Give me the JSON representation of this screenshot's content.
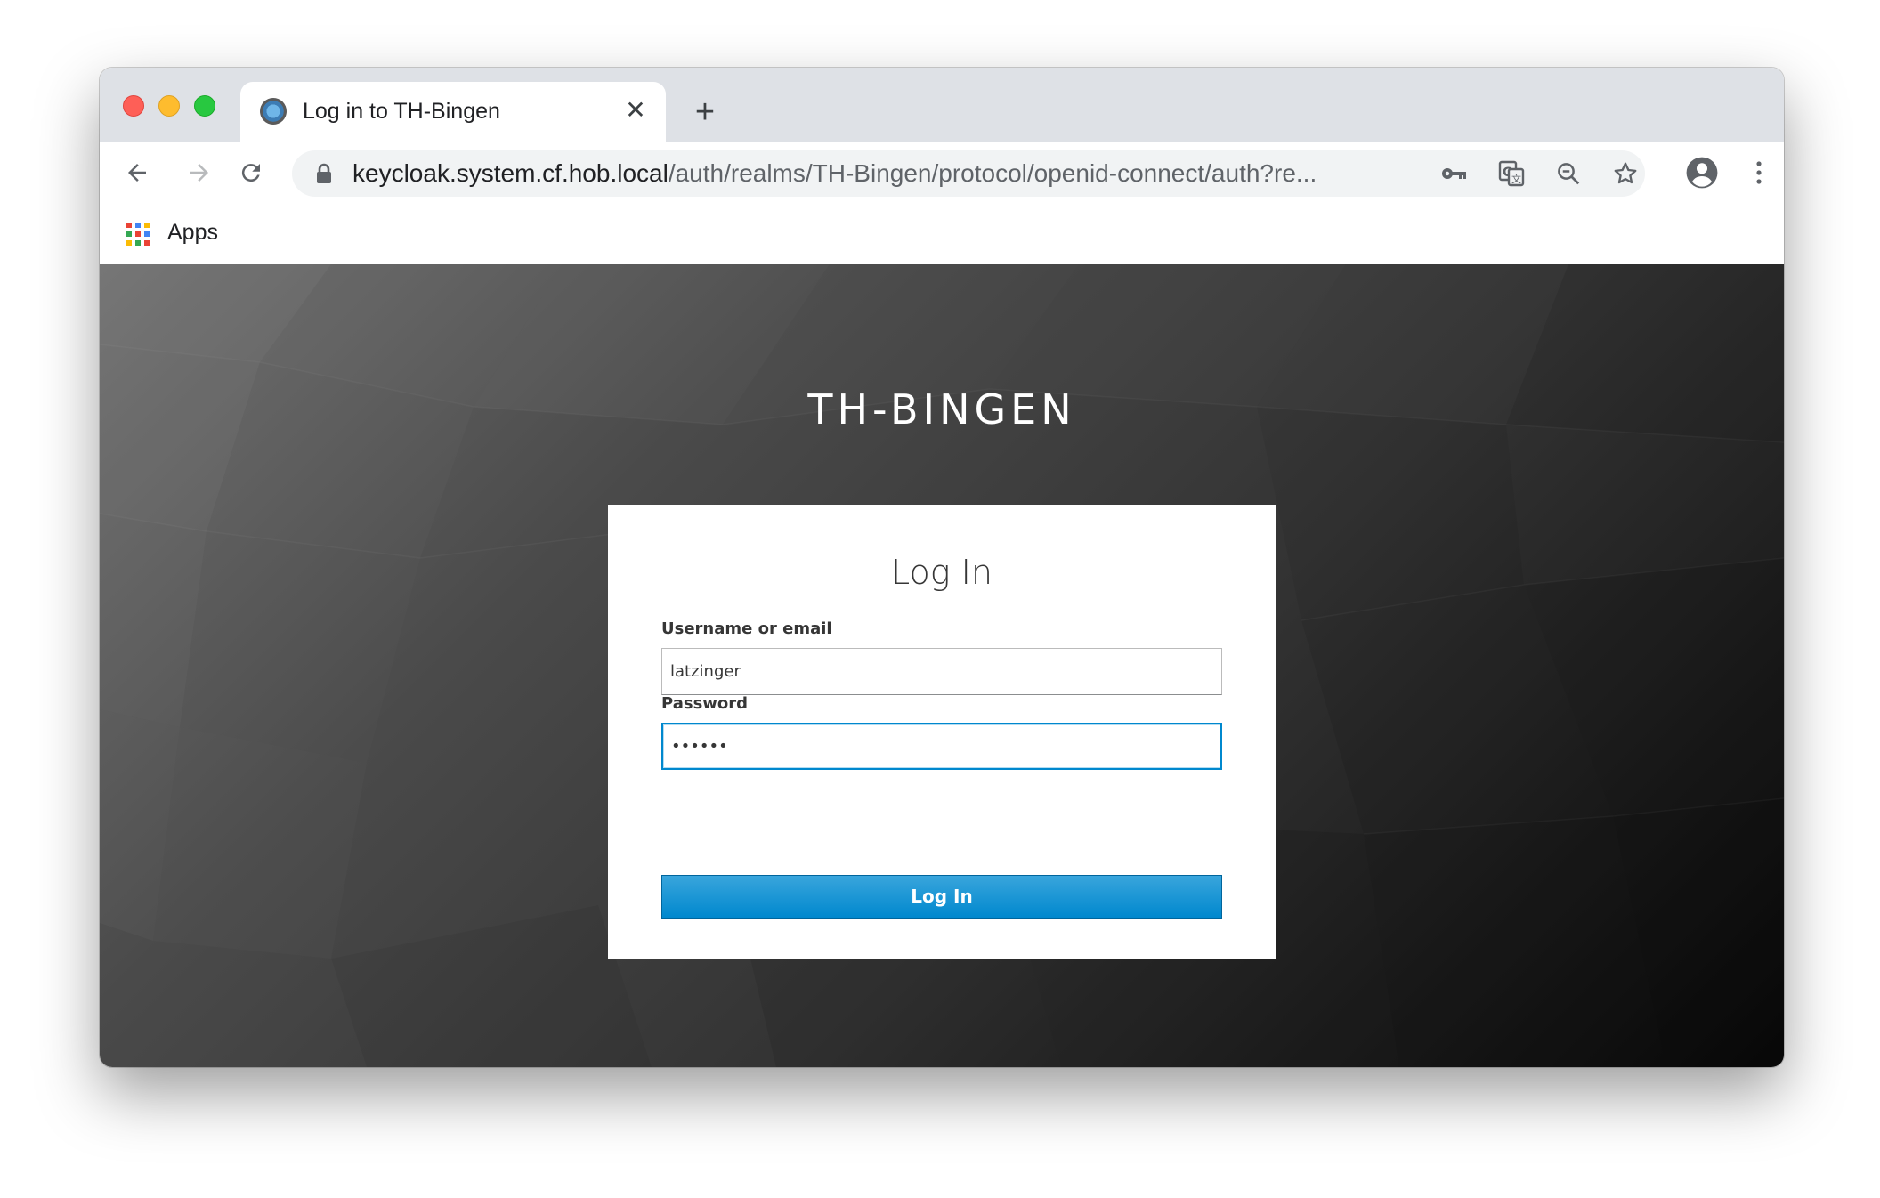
{
  "browser": {
    "tab": {
      "title": "Log in to TH-Bingen",
      "favicon": "keycloak-icon"
    },
    "omnibox": {
      "url_host": "keycloak.system.cf.hob.local",
      "url_path": "/auth/realms/TH-Bingen/protocol/openid-connect/auth?re..."
    },
    "bookmarks": {
      "apps_label": "Apps"
    },
    "colors": {
      "tabstrip": "#dee1e6",
      "omnibox": "#f1f3f4"
    }
  },
  "page": {
    "brand": "TH-BINGEN",
    "card_title": "Log In",
    "username": {
      "label": "Username or email",
      "value": "latzinger"
    },
    "password": {
      "label": "Password",
      "value": "••••••"
    },
    "login_button": "Log In",
    "colors": {
      "button": "#0088ce",
      "focus": "#0088ce"
    }
  }
}
